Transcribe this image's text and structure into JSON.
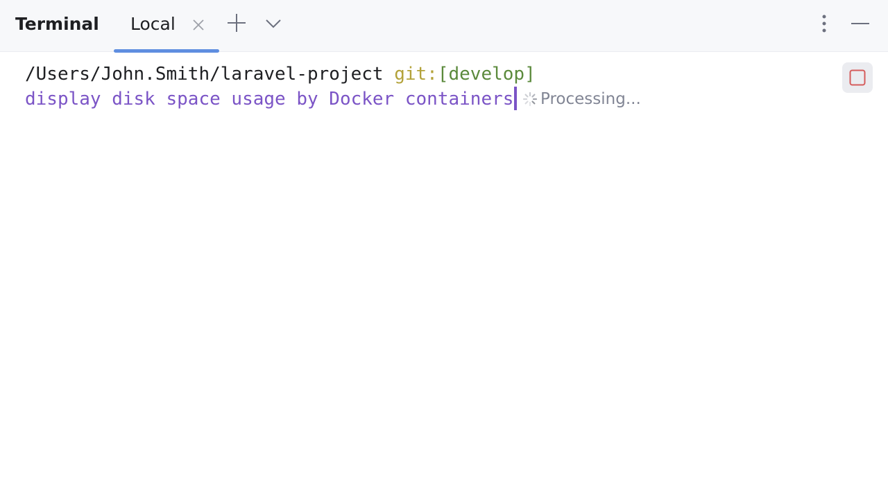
{
  "header": {
    "title": "Terminal",
    "tabs": [
      {
        "label": "Local",
        "active": true
      }
    ],
    "icons": {
      "close": "close-icon",
      "add": "plus-icon",
      "dropdown": "chevron-down-icon",
      "more": "more-vertical-icon",
      "minimize": "minimize-icon"
    }
  },
  "terminal": {
    "prompt": {
      "path": "/Users/John.Smith/laravel-project",
      "git_label": "git:",
      "branch": "[develop]"
    },
    "command": "display disk space usage by Docker containers",
    "status": "Processing...",
    "stop_icon": "stop-icon"
  },
  "colors": {
    "accent": "#5f8ee0",
    "command": "#7b54c6",
    "git_label": "#b3a23a",
    "branch": "#5b8a3c",
    "stop": "#d55b5b"
  }
}
